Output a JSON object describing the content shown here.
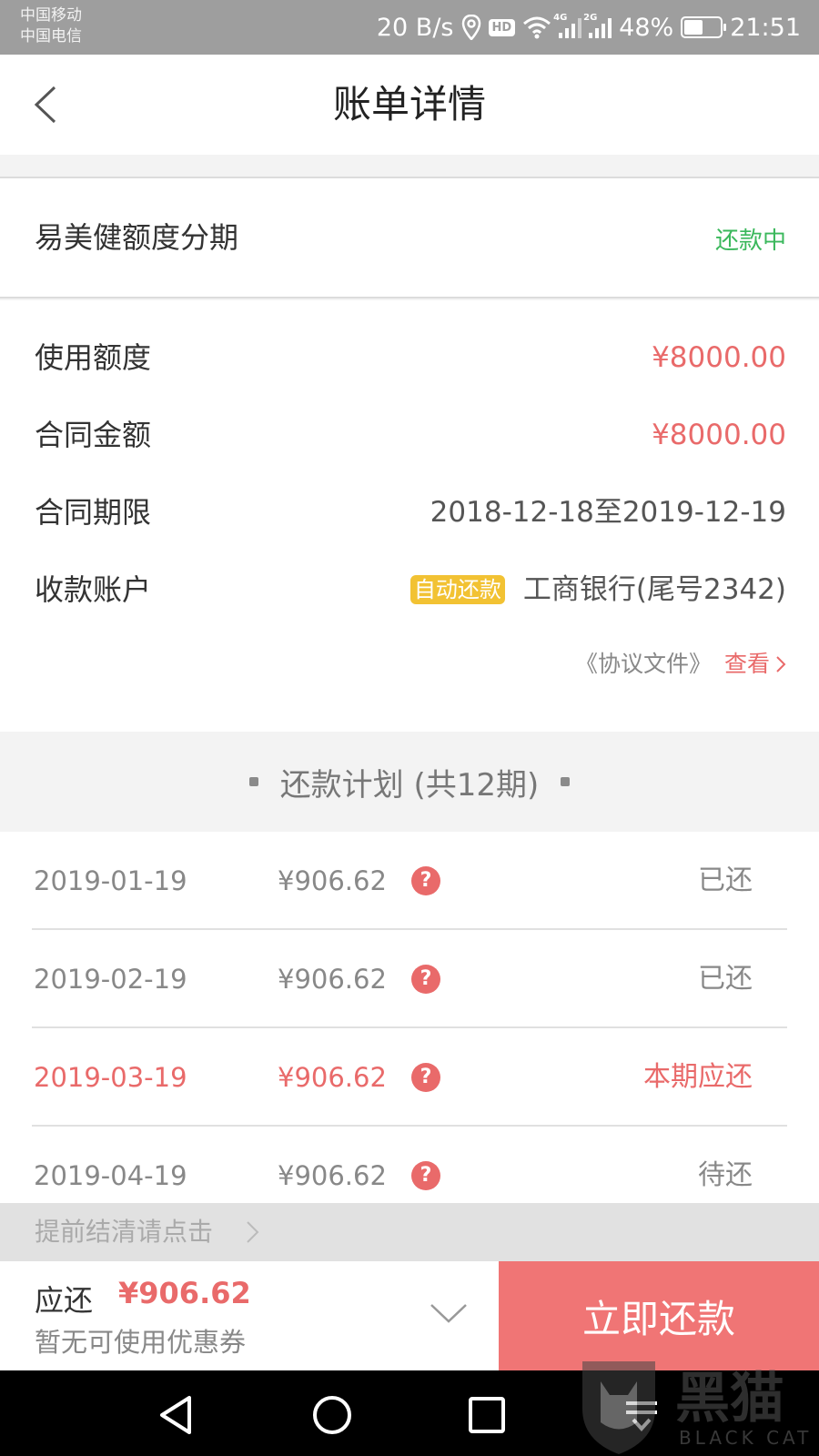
{
  "status_bar": {
    "carrier_1": "中国移动",
    "carrier_2": "中国电信",
    "net_speed": "20 B/s",
    "hd_badge": "HD",
    "sig_4g": "4G",
    "sig_2g": "2G",
    "battery_percent": "48%",
    "battery_level": 0.48,
    "time": "21:51"
  },
  "nav": {
    "title": "账单详情"
  },
  "product": {
    "name": "易美健额度分期",
    "status": "还款中"
  },
  "detail": {
    "rows": [
      {
        "label": "使用额度",
        "value": "¥8000.00"
      },
      {
        "label": "合同金额",
        "value": "¥8000.00"
      },
      {
        "label": "合同期限",
        "value": "2018-12-18至2019-12-19"
      }
    ],
    "account_label": "收款账户",
    "auto_repay_badge": "自动还款",
    "account_value": "工商银行(尾号2342)",
    "agreement_doc": "《协议文件》",
    "agreement_view": "查看"
  },
  "plan": {
    "title": "还款计划 (共12期)",
    "rows": [
      {
        "date": "2019-01-19",
        "amount": "¥906.62",
        "status": "已还"
      },
      {
        "date": "2019-02-19",
        "amount": "¥906.62",
        "status": "已还"
      },
      {
        "date": "2019-03-19",
        "amount": "¥906.62",
        "status": "本期应还"
      },
      {
        "date": "2019-04-19",
        "amount": "¥906.62",
        "status": "待还"
      }
    ],
    "help_glyph": "?"
  },
  "prepay": {
    "text": "提前结清请点击"
  },
  "footer": {
    "due_label": "应还",
    "due_amount": "¥906.62",
    "coupon_text": "暂无可使用优惠券",
    "pay_button": "立即还款"
  },
  "watermark": {
    "text": "黑猫",
    "sub": "BLACK CAT"
  },
  "colors": {
    "accent_red": "#e96a6a",
    "button_red": "#f07575",
    "status_green": "#3bb85c",
    "badge_yellow": "#f2c233"
  },
  "icons": [
    "back-chevron-icon",
    "location-icon",
    "wifi-icon",
    "signal-icon",
    "battery-icon",
    "help-icon",
    "chevron-right-icon",
    "chevron-down-icon",
    "nav-back-icon",
    "nav-home-icon",
    "nav-recents-icon",
    "cat-logo-icon"
  ]
}
